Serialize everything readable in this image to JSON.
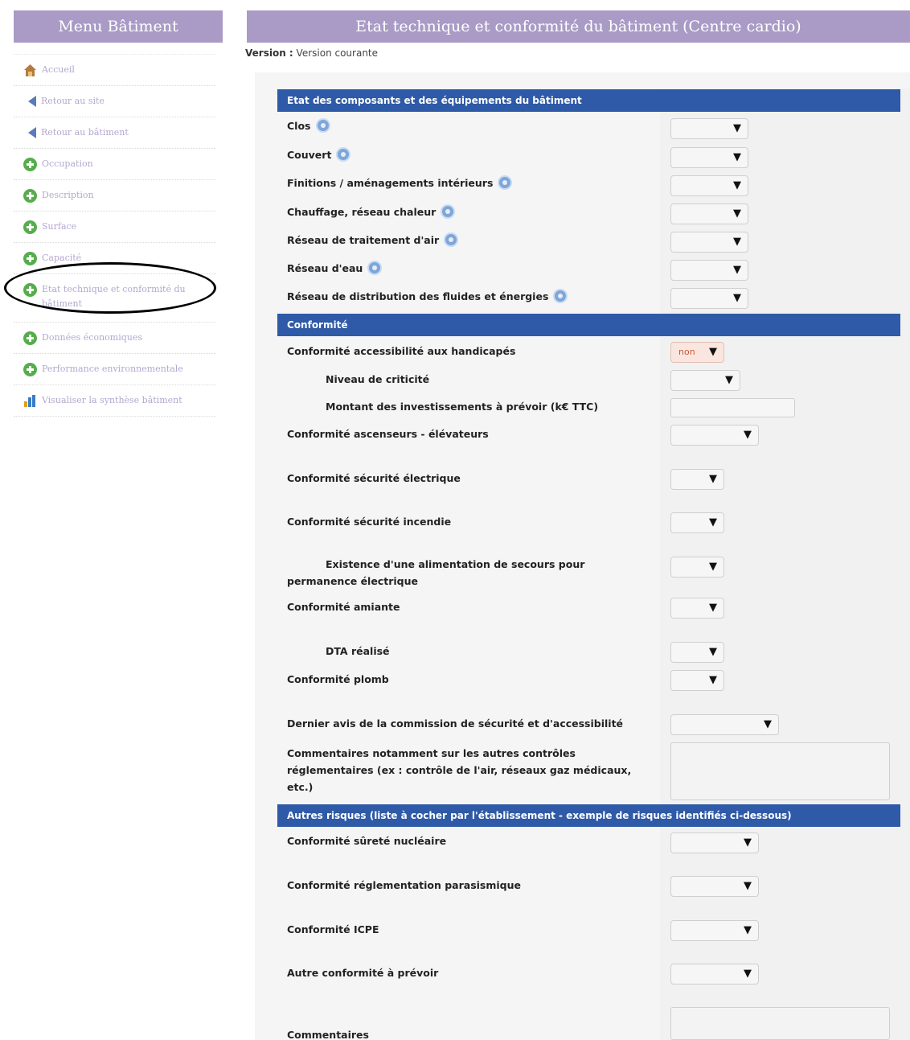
{
  "sidebar": {
    "title": "Menu Bâtiment",
    "items": [
      {
        "label": "Accueil"
      },
      {
        "label": "Retour au site"
      },
      {
        "label": "Retour au bâtiment"
      },
      {
        "label": "Occupation"
      },
      {
        "label": "Description"
      },
      {
        "label": "Surface"
      },
      {
        "label": "Capacité"
      },
      {
        "label": "Etat technique et conformité du bâtiment"
      },
      {
        "label": "Données économiques"
      },
      {
        "label": "Performance environnementale"
      },
      {
        "label": "Visualiser la synthèse bâtiment"
      }
    ]
  },
  "header": {
    "title": "Etat technique et conformité du bâtiment (Centre cardio)",
    "version_label": "Version :",
    "version_value": "Version courante"
  },
  "sections": {
    "etat": {
      "title": "Etat des composants et des équipements du bâtiment",
      "rows": [
        {
          "label": "Clos"
        },
        {
          "label": "Couvert"
        },
        {
          "label": "Finitions / aménagements intérieurs"
        },
        {
          "label": "Chauffage, réseau chaleur"
        },
        {
          "label": "Réseau de traitement d'air"
        },
        {
          "label": "Réseau d'eau"
        },
        {
          "label": "Réseau de distribution des fluides et énergies"
        }
      ]
    },
    "conformite": {
      "title": "Conformité",
      "rows": [
        {
          "label": "Conformité accessibilité aux handicapés",
          "value": "non"
        },
        {
          "label": "Niveau de criticité"
        },
        {
          "label": "Montant des investissements à prévoir (k€ TTC)"
        },
        {
          "label": "Conformité ascenseurs - élévateurs"
        },
        {
          "label": "Conformité sécurité électrique"
        },
        {
          "label": "Conformité sécurité incendie"
        },
        {
          "label": "Existence d'une alimentation de secours pour permanence électrique"
        },
        {
          "label": "Conformité amiante"
        },
        {
          "label": "DTA réalisé"
        },
        {
          "label": "Conformité plomb"
        },
        {
          "label": "Dernier avis de la commission de sécurité et d'accessibilité"
        },
        {
          "label": "Commentaires notamment sur les autres contrôles réglementaires (ex : contrôle de l'air, réseaux gaz médicaux, etc.)"
        }
      ]
    },
    "autres": {
      "title": "Autres risques (liste à cocher par l'établissement - exemple de risques identifiés ci-dessous)",
      "rows": [
        {
          "label": "Conformité sûreté nucléaire"
        },
        {
          "label": "Conformité réglementation parasismique"
        },
        {
          "label": "Conformité ICPE"
        },
        {
          "label": "Autre conformité à prévoir"
        },
        {
          "label": "Commentaires"
        }
      ]
    }
  },
  "caret": "▼"
}
